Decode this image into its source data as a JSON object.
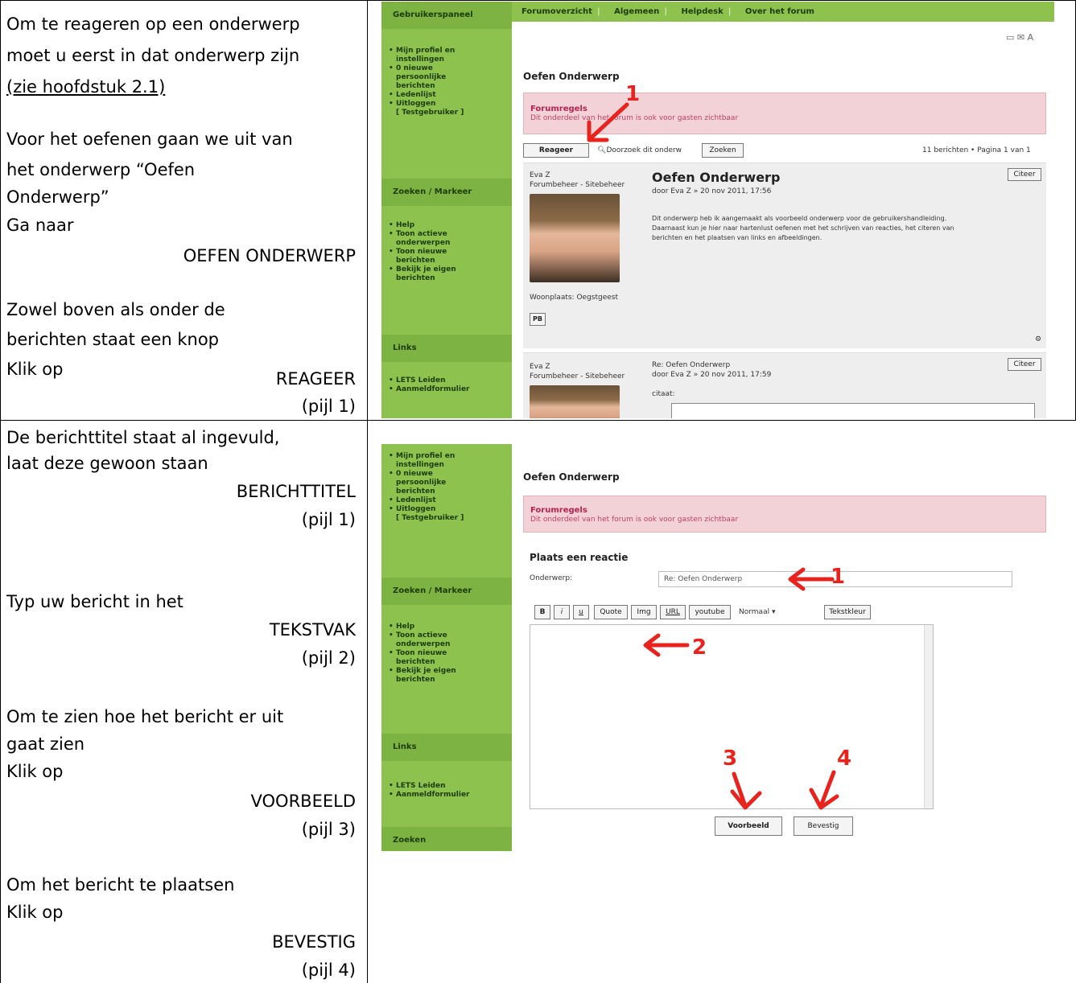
{
  "left_col": {
    "row1": {
      "l1": "Om te reageren op een onderwerp",
      "l2": "moet u eerst in dat onderwerp zijn",
      "l3_link": "(zie hoofdstuk 2.1)",
      "l4": "Voor het oefenen gaan we uit van",
      "l5": "het onderwerp “Oefen",
      "l6": "Onderwerp”",
      "l7": "Ga naar",
      "l8": "OEFEN ONDERWERP",
      "l9": "Zowel boven als onder de",
      "l10": "berichten staat een knop",
      "l11": "Klik op",
      "l12": "REAGEER",
      "l13": "(pijl 1)"
    },
    "row2": {
      "l1": "De berichttitel staat al ingevuld,",
      "l2": "laat deze gewoon staan",
      "l3": "BERICHTTITEL",
      "l4": "(pijl 1)",
      "l5": "Typ uw bericht in het",
      "l6": "TEKSTVAK",
      "l7": "(pijl 2)",
      "l8": "Om te zien hoe het bericht er uit",
      "l9": "gaat zien",
      "l10": "Klik op",
      "l11": "VOORBEELD",
      "l12": "(pijl 3)",
      "l13": "Om het bericht te plaatsen",
      "l14": "Klik op",
      "l15": "BEVESTIG",
      "l16": "(pijl 4)"
    }
  },
  "shot1": {
    "sidebar_head1": "Gebruikerspaneel",
    "sidebar_list1": [
      "Mijn profiel en",
      "instellingen",
      "0 nieuwe",
      "persoonlijke",
      "berichten",
      "Ledenlijst",
      "Uitloggen",
      "[ Testgebruiker ]"
    ],
    "sidebar_head2": "Zoeken / Markeer",
    "sidebar_list2": [
      "Help",
      "Toon actieve",
      "onderwerpen",
      "Toon nieuwe",
      "berichten",
      "Bekijk je eigen",
      "berichten"
    ],
    "sidebar_head3": "Links",
    "sidebar_list3": [
      "LETS Leiden",
      "Aanmeldformulier"
    ],
    "nav": [
      "Forumoverzicht",
      "Algemeen",
      "Helpdesk",
      "Over het forum"
    ],
    "title": "Oefen Onderwerp",
    "rules_title": "Forumregels",
    "rules_text": "Dit onderdeel van het forum is ook voor gasten zichtbaar",
    "reply_button": "Reageer",
    "search_placeholder": "Doorzoek dit onderw",
    "search_button": "Zoeken",
    "pagination": "11 berichten • Pagina 1 van 1",
    "post1_author": "Eva Z",
    "post1_rank": "Forumbeheer - Sitebeheer",
    "post1_title": "Oefen Onderwerp",
    "post1_meta": "door Eva Z » 20 nov 2011, 17:56",
    "post1_body": [
      "Dit onderwerp heb ik aangemaakt als voorbeeld onderwerp voor de gebruikershandleiding.",
      "Daarnaast kun je hier naar hartenlust oefenen met het schrijven van reacties, het citeren van",
      "berichten en het plaatsen van links en afbeeldingen."
    ],
    "post1_location": "Woonplaats: Oegstgeest",
    "pm_button": "PB",
    "quote_button": "Citeer",
    "post2_author": "Eva Z",
    "post2_rank": "Forumbeheer - Sitebeheer",
    "post2_title": "Re: Oefen Onderwerp",
    "post2_meta": "door Eva Z » 20 nov 2011, 17:59",
    "post2_body": "citaat:",
    "arrow1": "1"
  },
  "shot2": {
    "sidebar_list1": [
      "Mijn profiel en",
      "instellingen",
      "0 nieuwe",
      "persoonlijke",
      "berichten",
      "Ledenlijst",
      "Uitloggen",
      "[ Testgebruiker ]"
    ],
    "sidebar_head2": "Zoeken / Markeer",
    "sidebar_list2": [
      "Help",
      "Toon actieve",
      "onderwerpen",
      "Toon nieuwe",
      "berichten",
      "Bekijk je eigen",
      "berichten"
    ],
    "sidebar_head3": "Links",
    "sidebar_list3": [
      "LETS Leiden",
      "Aanmeldformulier"
    ],
    "sidebar_head4": "Zoeken",
    "title": "Oefen Onderwerp",
    "rules_title": "Forumregels",
    "rules_text": "Dit onderdeel van het forum is ook voor gasten zichtbaar",
    "reply_heading": "Plaats een reactie",
    "subject_label": "Onderwerp:",
    "subject_value": "Re: Oefen Onderwerp",
    "toolbar": [
      "B",
      "i",
      "u",
      "Quote",
      "Img",
      "URL",
      "youtube",
      "Normaal",
      "Tekstkleur"
    ],
    "preview_button": "Voorbeeld",
    "submit_button": "Bevestig",
    "arrow1": "1",
    "arrow2": "2",
    "arrow3": "3",
    "arrow4": "4"
  }
}
